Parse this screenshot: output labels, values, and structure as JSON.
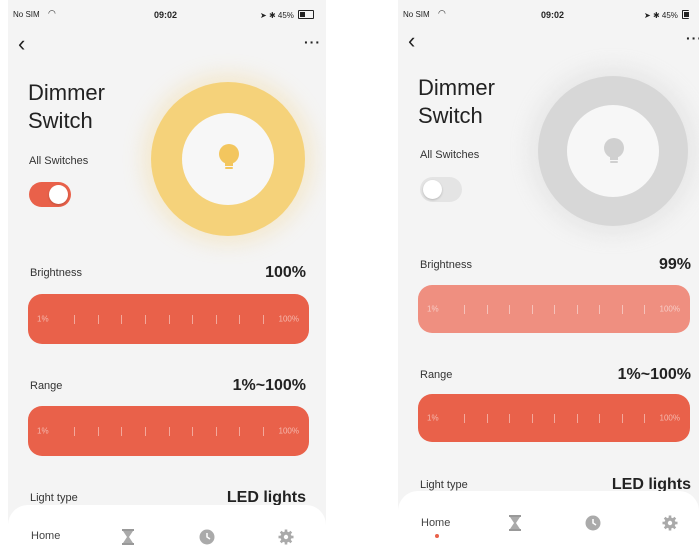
{
  "status": {
    "carrier": "No SIM",
    "time": "09:02",
    "battery": "45%"
  },
  "screens": [
    {
      "title_line1": "Dimmer",
      "title_line2": "Switch",
      "all_switches_label": "All Switches",
      "toggle_on": true,
      "brightness_label": "Brightness",
      "brightness_value": "100%",
      "slider_min": "1%",
      "slider_max": "100%",
      "range_label": "Range",
      "range_value": "1%~100%",
      "light_type_label": "Light type",
      "light_type_value": "LED lights",
      "nav_home": "Home",
      "colors": {
        "accent": "#e9614a",
        "ring": "#f5d27a",
        "bulb": "#f3c65e"
      }
    },
    {
      "title_line1": "Dimmer",
      "title_line2": "Switch",
      "all_switches_label": "All Switches",
      "toggle_on": false,
      "brightness_label": "Brightness",
      "brightness_value": "99%",
      "slider_min": "1%",
      "slider_max": "100%",
      "range_label": "Range",
      "range_value": "1%~100%",
      "light_type_label": "Light type",
      "light_type_value": "LED lights",
      "nav_home": "Home",
      "colors": {
        "accent": "#e9614a",
        "accent_light": "#ef8f80",
        "ring": "#d7d7d7",
        "bulb": "#d0d0d0"
      }
    }
  ],
  "icons": {
    "back": "chevron-left-icon",
    "more": "more-icon",
    "bulb": "light-bulb-icon",
    "nav": [
      "home",
      "hourglass-icon",
      "clock-icon",
      "gear-icon"
    ]
  }
}
